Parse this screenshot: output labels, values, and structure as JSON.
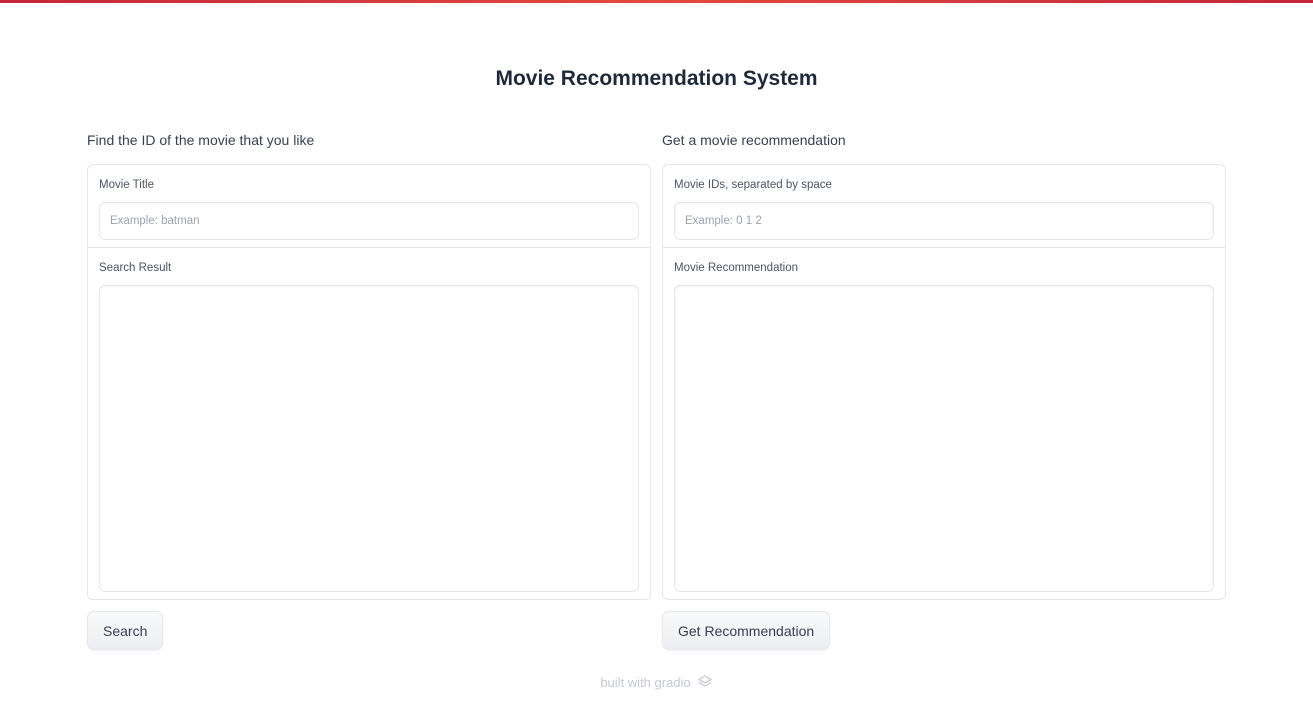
{
  "page": {
    "title": "Movie Recommendation System"
  },
  "left": {
    "heading": "Find the ID of the movie that you like",
    "input_label": "Movie Title",
    "input_value": "",
    "input_placeholder": "Example: batman",
    "output_label": "Search Result",
    "output_value": "",
    "button_label": "Search"
  },
  "right": {
    "heading": "Get a movie recommendation",
    "input_label": "Movie IDs, separated by space",
    "input_value": "",
    "input_placeholder": "Example: 0 1 2",
    "output_label": "Movie Recommendation",
    "output_value": "",
    "button_label": "Get Recommendation"
  },
  "footer": {
    "text": "built with gradio",
    "icon": "gradio-logo-icon"
  },
  "colors": {
    "accent_bar": "#c2273a",
    "border": "#e5e7eb",
    "text": "#1f2937",
    "muted": "#9ca3af"
  }
}
